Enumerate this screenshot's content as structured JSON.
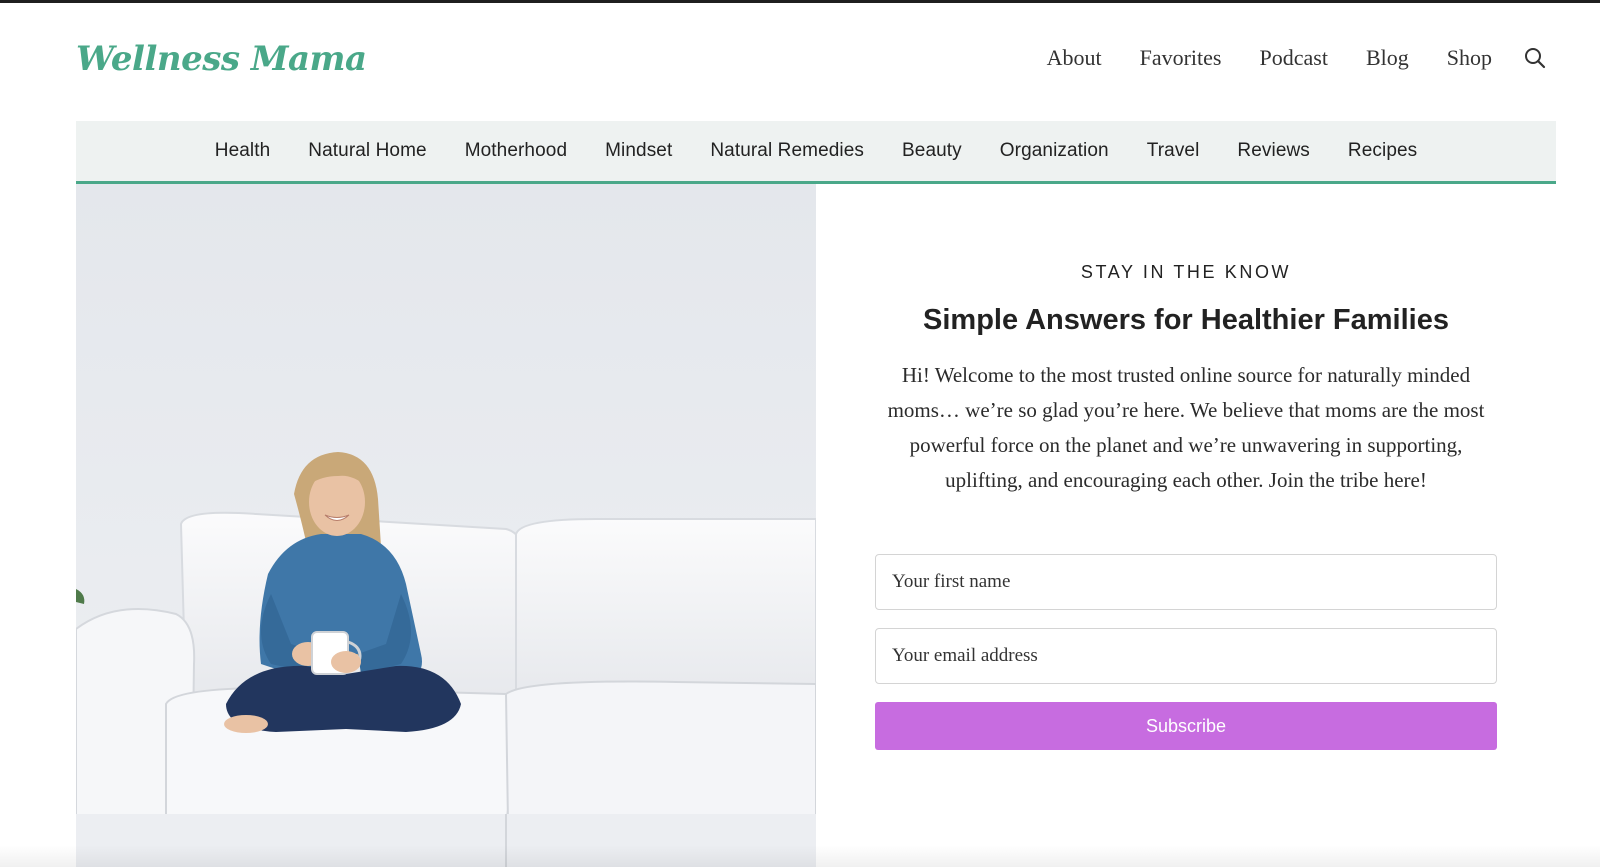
{
  "header": {
    "logo_text": "Wellness Mama",
    "nav": [
      {
        "label": "About"
      },
      {
        "label": "Favorites"
      },
      {
        "label": "Podcast"
      },
      {
        "label": "Blog"
      },
      {
        "label": "Shop"
      }
    ],
    "search_icon": "search-icon"
  },
  "category_nav": {
    "items": [
      {
        "label": "Health"
      },
      {
        "label": "Natural Home"
      },
      {
        "label": "Motherhood"
      },
      {
        "label": "Mindset"
      },
      {
        "label": "Natural Remedies"
      },
      {
        "label": "Beauty"
      },
      {
        "label": "Organization"
      },
      {
        "label": "Travel"
      },
      {
        "label": "Reviews"
      },
      {
        "label": "Recipes"
      }
    ]
  },
  "signup": {
    "eyebrow": "STAY IN THE KNOW",
    "headline": "Simple Answers for Healthier Families",
    "intro": "Hi! Welcome to the most trusted online source for naturally minded moms… we’re so glad you’re here. We believe that moms are the most powerful force on the planet and we’re unwavering in supporting, uplifting, and encouraging each other. Join the tribe here!",
    "first_name_placeholder": "Your first name",
    "email_placeholder": "Your email address",
    "submit_label": "Subscribe"
  },
  "colors": {
    "brand_green": "#4aa889",
    "button_purple": "#c76ce0",
    "nav_background": "#eef2f1"
  }
}
